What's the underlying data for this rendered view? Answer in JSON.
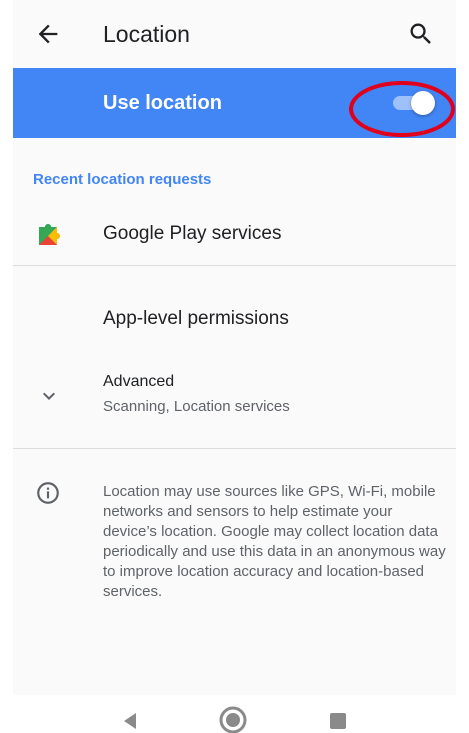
{
  "app_bar": {
    "title": "Location",
    "back_icon": "arrow-back-icon",
    "search_icon": "search-icon"
  },
  "master_switch": {
    "label": "Use location",
    "state": "on"
  },
  "recent_requests": {
    "header": "Recent location requests",
    "items": [
      {
        "label": "Google Play services",
        "icon": "google-play-services-icon"
      }
    ]
  },
  "app_level": {
    "label": "App-level permissions"
  },
  "advanced": {
    "title": "Advanced",
    "summary": "Scanning, Location services",
    "icon": "chevron-down-icon"
  },
  "footer": {
    "icon": "info-icon",
    "text": "Location may use sources like GPS, Wi-Fi, mobile networks and sensors to help estimate your device’s location. Google may collect location data periodically and use this data in an anonymous way to improve location accuracy and location-based services."
  },
  "colors": {
    "accent": "#4285f4",
    "annotation": "#e0001b"
  },
  "nav": {
    "back": "nav-back-icon",
    "home": "nav-home-icon",
    "recents": "nav-recents-icon"
  }
}
